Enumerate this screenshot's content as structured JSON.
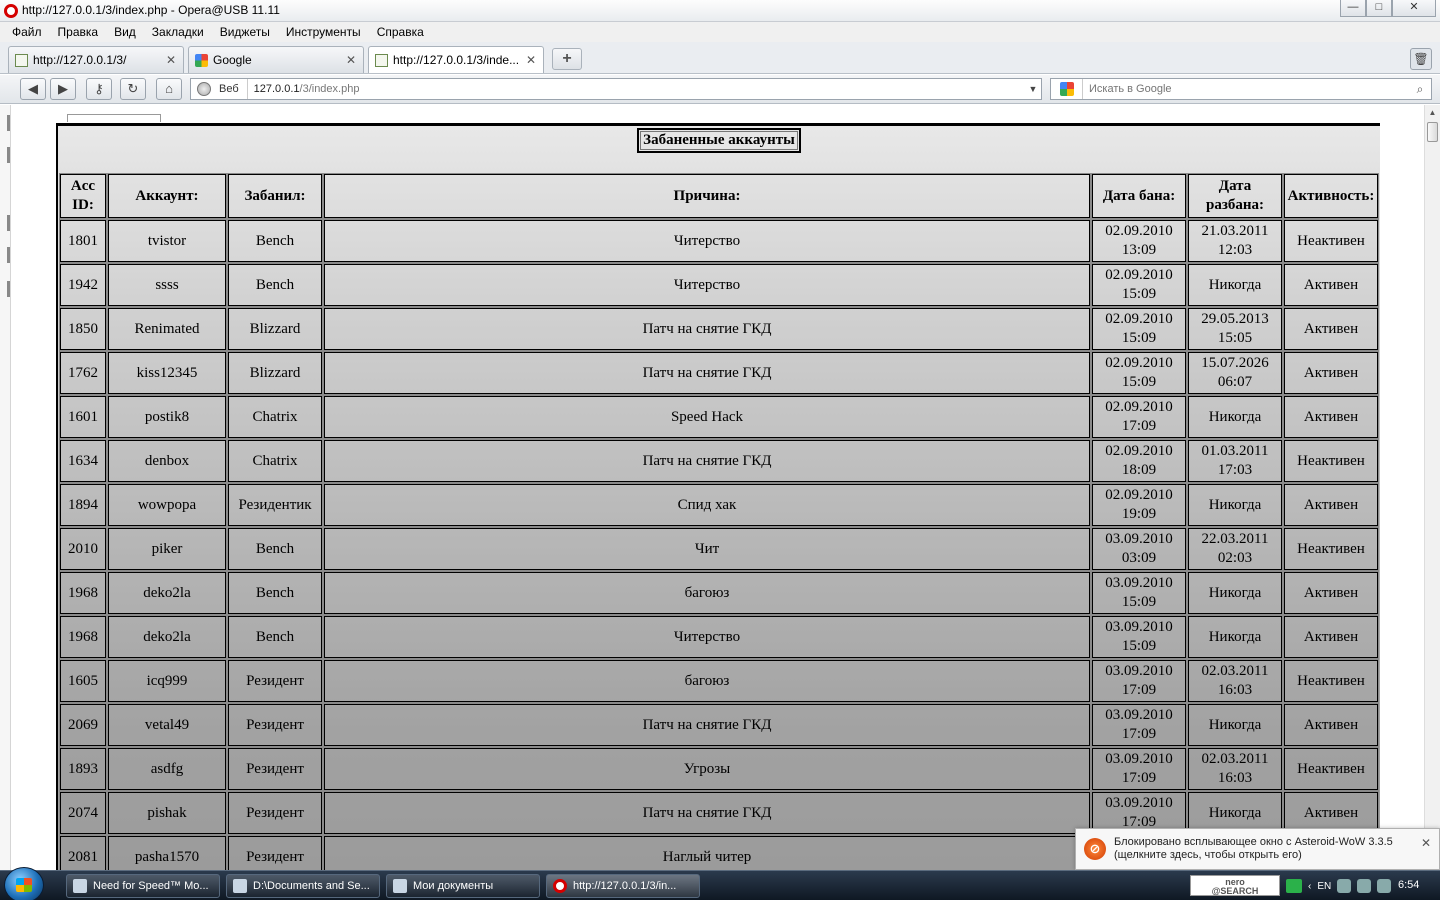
{
  "window": {
    "title": "http://127.0.0.1/3/index.php - Opera@USB 11.11",
    "controls": {
      "minimize": "—",
      "maximize": "□",
      "close": "✕"
    }
  },
  "menu": [
    "Файл",
    "Правка",
    "Вид",
    "Закладки",
    "Виджеты",
    "Инструменты",
    "Справка"
  ],
  "tabs": [
    {
      "label": "http://127.0.0.1/3/",
      "icon": "page-icon",
      "active": false
    },
    {
      "label": "Google",
      "icon": "google-icon",
      "active": false
    },
    {
      "label": "http://127.0.0.1/3/inde...",
      "icon": "page-icon",
      "active": true
    }
  ],
  "address": {
    "scope": "Веб",
    "host": "127.0.0.1",
    "path": "/3/index.php"
  },
  "search": {
    "placeholder": "Искать в Google"
  },
  "page": {
    "caption": "Забаненные аккаунты",
    "headers": [
      "Acc ID:",
      "Аккаунт:",
      "Забанил:",
      "Причина:",
      "Дата бана:",
      "Дата разбана:",
      "Активность:"
    ],
    "rows": [
      {
        "id": "1801",
        "account": "tvistor",
        "by": "Bench",
        "reason": "Читерство",
        "ban_date": "02.09.2010",
        "ban_time": "13:09",
        "unban_date": "21.03.2011",
        "unban_time": "12:03",
        "status": "Неактивен"
      },
      {
        "id": "1942",
        "account": "ssss",
        "by": "Bench",
        "reason": "Читерство",
        "ban_date": "02.09.2010",
        "ban_time": "15:09",
        "unban_date": "Никогда",
        "unban_time": "",
        "status": "Активен"
      },
      {
        "id": "1850",
        "account": "Renimated",
        "by": "Blizzard",
        "reason": "Патч на снятие ГКД",
        "ban_date": "02.09.2010",
        "ban_time": "15:09",
        "unban_date": "29.05.2013",
        "unban_time": "15:05",
        "status": "Активен"
      },
      {
        "id": "1762",
        "account": "kiss12345",
        "by": "Blizzard",
        "reason": "Патч на снятие ГКД",
        "ban_date": "02.09.2010",
        "ban_time": "15:09",
        "unban_date": "15.07.2026",
        "unban_time": "06:07",
        "status": "Активен"
      },
      {
        "id": "1601",
        "account": "postik8",
        "by": "Chatrix",
        "reason": "Speed Hack",
        "ban_date": "02.09.2010",
        "ban_time": "17:09",
        "unban_date": "Никогда",
        "unban_time": "",
        "status": "Активен"
      },
      {
        "id": "1634",
        "account": "denbox",
        "by": "Chatrix",
        "reason": "Патч на снятие ГКД",
        "ban_date": "02.09.2010",
        "ban_time": "18:09",
        "unban_date": "01.03.2011",
        "unban_time": "17:03",
        "status": "Неактивен"
      },
      {
        "id": "1894",
        "account": "wowpopa",
        "by": "Резидентик",
        "reason": "Спид хак",
        "ban_date": "02.09.2010",
        "ban_time": "19:09",
        "unban_date": "Никогда",
        "unban_time": "",
        "status": "Активен"
      },
      {
        "id": "2010",
        "account": "piker",
        "by": "Bench",
        "reason": "Чит",
        "ban_date": "03.09.2010",
        "ban_time": "03:09",
        "unban_date": "22.03.2011",
        "unban_time": "02:03",
        "status": "Неактивен"
      },
      {
        "id": "1968",
        "account": "deko2la",
        "by": "Bench",
        "reason": "багоюз",
        "ban_date": "03.09.2010",
        "ban_time": "15:09",
        "unban_date": "Никогда",
        "unban_time": "",
        "status": "Активен"
      },
      {
        "id": "1968",
        "account": "deko2la",
        "by": "Bench",
        "reason": "Читерство",
        "ban_date": "03.09.2010",
        "ban_time": "15:09",
        "unban_date": "Никогда",
        "unban_time": "",
        "status": "Активен"
      },
      {
        "id": "1605",
        "account": "icq999",
        "by": "Резидент",
        "reason": "багоюз",
        "ban_date": "03.09.2010",
        "ban_time": "17:09",
        "unban_date": "02.03.2011",
        "unban_time": "16:03",
        "status": "Неактивен"
      },
      {
        "id": "2069",
        "account": "vetal49",
        "by": "Резидент",
        "reason": "Патч на снятие ГКД",
        "ban_date": "03.09.2010",
        "ban_time": "17:09",
        "unban_date": "Никогда",
        "unban_time": "",
        "status": "Активен"
      },
      {
        "id": "1893",
        "account": "asdfg",
        "by": "Резидент",
        "reason": "Угрозы",
        "ban_date": "03.09.2010",
        "ban_time": "17:09",
        "unban_date": "02.03.2011",
        "unban_time": "16:03",
        "status": "Неактивен"
      },
      {
        "id": "2074",
        "account": "pishak",
        "by": "Резидент",
        "reason": "Патч на снятие ГКД",
        "ban_date": "03.09.2010",
        "ban_time": "17:09",
        "unban_date": "Никогда",
        "unban_time": "",
        "status": "Активен"
      },
      {
        "id": "2081",
        "account": "pasha1570",
        "by": "Резидент",
        "reason": "Наглый читер",
        "ban_date": "",
        "ban_time": "",
        "unban_date": "",
        "unban_time": "",
        "status": ""
      }
    ]
  },
  "popup": {
    "line1": "Блокировано всплывающее окно с Asteroid-WoW 3.3.5",
    "line2": "(щелкните здесь, чтобы открыть его)",
    "close": "✕"
  },
  "taskbar": {
    "buttons": [
      {
        "label": "Need for Speed™ Mo...",
        "icon": "game-icon",
        "active": false
      },
      {
        "label": "D:\\Documents and Se...",
        "icon": "folder-icon",
        "active": false
      },
      {
        "label": "Мои документы",
        "icon": "folder-icon",
        "active": false
      },
      {
        "label": "http://127.0.0.1/3/in...",
        "icon": "opera-icon",
        "active": true
      }
    ],
    "nero_line1": "nero",
    "nero_line2": "@SEARCH",
    "tray_lang": "EN",
    "clock": "6:54"
  }
}
